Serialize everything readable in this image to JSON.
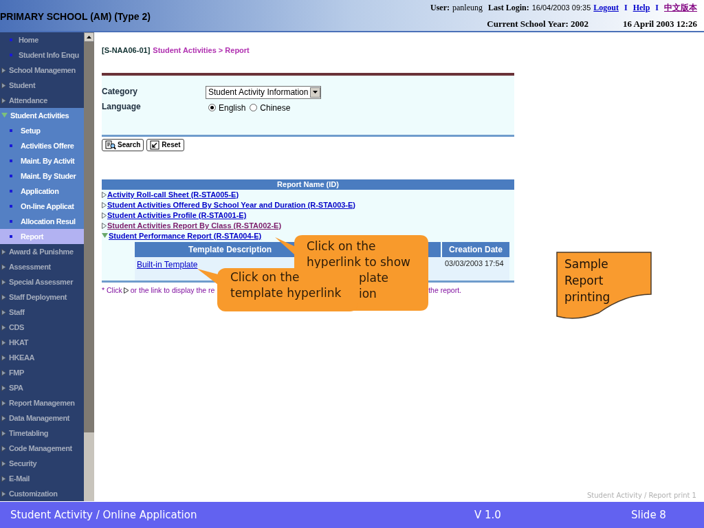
{
  "header": {
    "title": "PRIMARY SCHOOL (AM) (Type 2)",
    "user_label": "User:",
    "user": "panleung",
    "last_login_label": "Last Login:",
    "last_login": "16/04/2003 09:35",
    "separators": [
      "I",
      "I"
    ],
    "links": [
      {
        "label": "Logout",
        "visited": false
      },
      {
        "label": "Help",
        "visited": false
      },
      {
        "label": "中文版本",
        "visited": true
      }
    ],
    "school_year": "Current School Year: 2002",
    "datetime": "16 April 2003 12:26"
  },
  "sidebar": {
    "items": [
      {
        "label": "Home",
        "kind": "page"
      },
      {
        "label": "Student Info Enqu",
        "kind": "page"
      },
      {
        "label": "School Managemen",
        "kind": "section",
        "expanded": false
      },
      {
        "label": "Student",
        "kind": "section",
        "expanded": false
      },
      {
        "label": "Attendance",
        "kind": "section",
        "expanded": false
      },
      {
        "label": "Student Activities",
        "kind": "section",
        "expanded": true,
        "children": [
          {
            "label": "Setup",
            "selected": false
          },
          {
            "label": "Activities Offere",
            "selected": false
          },
          {
            "label": "Maint. By Activit",
            "selected": false
          },
          {
            "label": "Maint. By Studer",
            "selected": false
          },
          {
            "label": "Application",
            "selected": false
          },
          {
            "label": "On-line Applicat",
            "selected": false
          },
          {
            "label": "Allocation Resul",
            "selected": false
          },
          {
            "label": "Report",
            "selected": true
          }
        ]
      },
      {
        "label": "Award & Punishme",
        "kind": "section",
        "expanded": false
      },
      {
        "label": "Assessment",
        "kind": "section",
        "expanded": false
      },
      {
        "label": "Special Assessmer",
        "kind": "section",
        "expanded": false
      },
      {
        "label": "Staff Deployment",
        "kind": "section",
        "expanded": false
      },
      {
        "label": "Staff",
        "kind": "section",
        "expanded": false
      },
      {
        "label": "CDS",
        "kind": "section",
        "expanded": false
      },
      {
        "label": "HKAT",
        "kind": "section",
        "expanded": false
      },
      {
        "label": "HKEAA",
        "kind": "section",
        "expanded": false
      },
      {
        "label": "FMP",
        "kind": "section",
        "expanded": false
      },
      {
        "label": "SPA",
        "kind": "section",
        "expanded": false
      },
      {
        "label": "Report Managemen",
        "kind": "section",
        "expanded": false
      },
      {
        "label": "Data Management",
        "kind": "section",
        "expanded": false
      },
      {
        "label": "Timetabling",
        "kind": "section",
        "expanded": false
      },
      {
        "label": "Code Management",
        "kind": "section",
        "expanded": false
      },
      {
        "label": "Security",
        "kind": "section",
        "expanded": false
      },
      {
        "label": "E-Mail",
        "kind": "section",
        "expanded": false
      },
      {
        "label": "Customization",
        "kind": "section",
        "expanded": false
      }
    ]
  },
  "breadcrumb": {
    "code": "[S-NAA06-01]",
    "path": "Student Activities > Report"
  },
  "form": {
    "category_label": "Category",
    "category_value": "Student Activity Information",
    "language_label": "Language",
    "languages": [
      {
        "label": "English",
        "selected": true
      },
      {
        "label": "Chinese",
        "selected": false
      }
    ],
    "buttons": [
      {
        "label": "Search",
        "kind": "search"
      },
      {
        "label": "Reset",
        "kind": "reset"
      }
    ]
  },
  "report_table": {
    "header": "Report Name (ID)",
    "rows": [
      {
        "label": "Activity Roll-call Sheet (R-STA005-E)",
        "visited": false,
        "expanded": false
      },
      {
        "label": "Student Activities Offered By School Year and Duration (R-STA003-E)",
        "visited": false,
        "expanded": false
      },
      {
        "label": "Student Activities Profile (R-STA001-E)",
        "visited": false,
        "expanded": false
      },
      {
        "label": "Student Activities Report By Class (R-STA002-E)",
        "visited": true,
        "expanded": false
      },
      {
        "label": "Student Performance Report (R-STA004-E)",
        "visited": false,
        "expanded": true,
        "template_table": {
          "columns": [
            "Template Description",
            "Creation Date"
          ],
          "rows": [
            [
              "Built-in Template",
              "03/03/2003 17:54"
            ]
          ]
        }
      }
    ],
    "footnote": {
      "start": "* Click",
      "middle": "or the link to display the re",
      "end": "the report."
    }
  },
  "callouts": [
    {
      "lines": [
        "Click on the",
        "hyperlink to show",
        "plate",
        "ion"
      ]
    },
    {
      "lines": [
        "Click on the template hyperlink"
      ]
    }
  ],
  "note": "Sample Report printing",
  "slide_caption": "Student Activity / Report print 1",
  "footer": {
    "title": "Student Activity / Online Application",
    "version": "V 1.0",
    "slide": "Slide 8"
  }
}
